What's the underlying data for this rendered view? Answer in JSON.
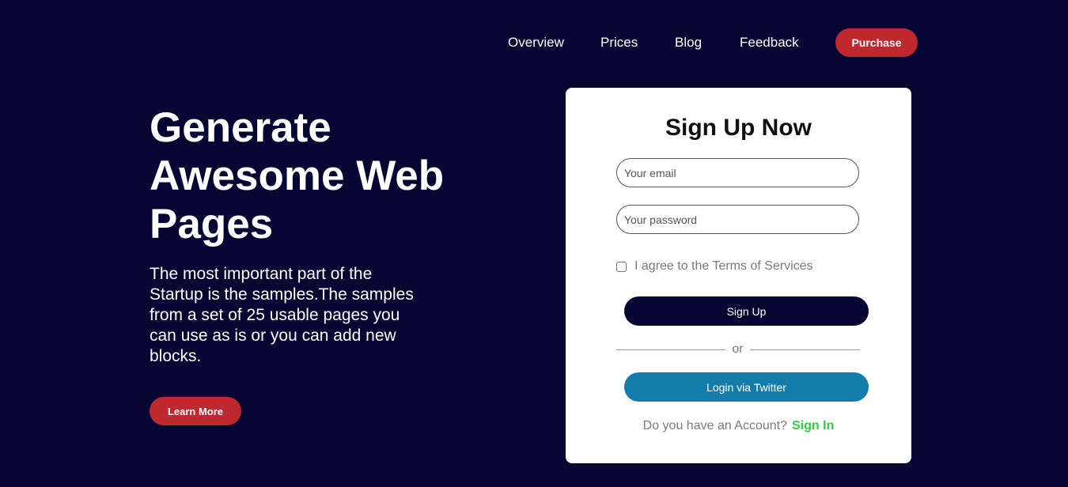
{
  "nav": {
    "items": [
      {
        "label": "Overview"
      },
      {
        "label": "Prices"
      },
      {
        "label": "Blog"
      },
      {
        "label": "Feedback"
      }
    ],
    "purchase_label": "Purchase"
  },
  "hero": {
    "title": "Generate Awesome Web Pages",
    "description": "The most important part of the Startup is the samples.The samples from a set of 25 usable pages you can use as is or you can add new blocks.",
    "cta_label": "Learn More"
  },
  "signup": {
    "title": "Sign Up Now",
    "email_placeholder": "Your email",
    "password_placeholder": "Your password",
    "terms_label": "I agree to the Terms of Services",
    "terms_checked": false,
    "submit_label": "Sign Up",
    "divider_text": "or",
    "twitter_label": "Login via Twitter",
    "account_prompt": "Do you have an Account?",
    "signin_label": "Sign In"
  },
  "colors": {
    "background": "#060633",
    "accent_red": "#c0282f",
    "twitter_blue": "#137cab",
    "signin_green": "#2ecc40"
  }
}
